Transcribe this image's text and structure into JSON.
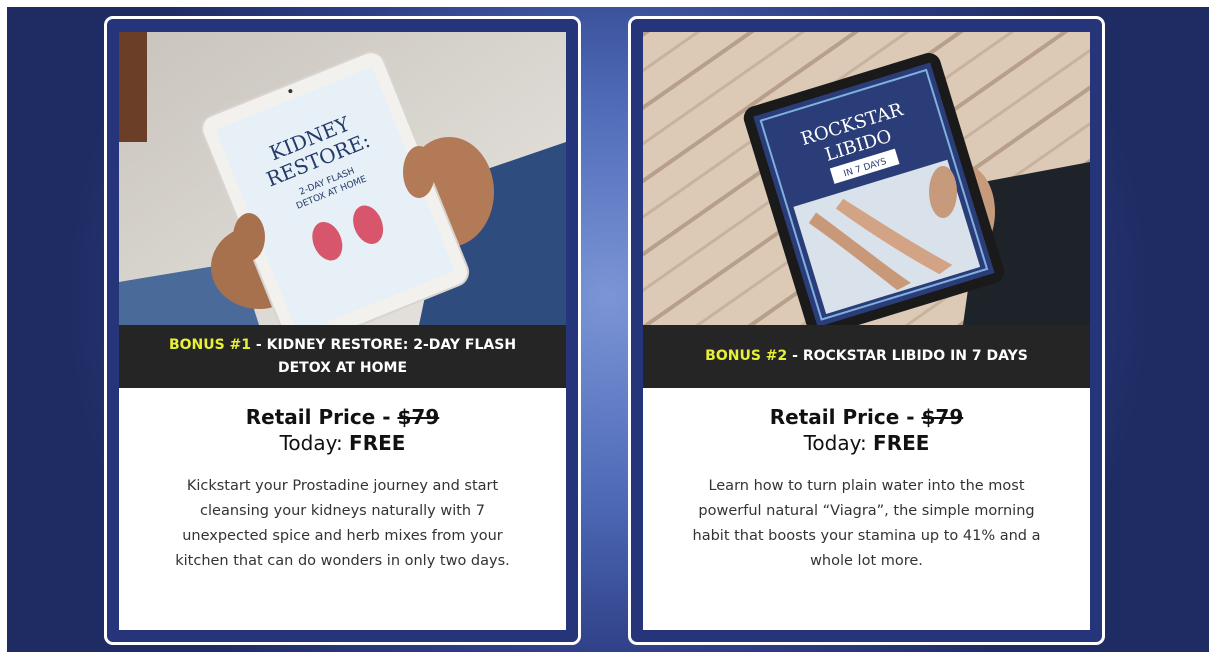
{
  "cards": [
    {
      "bonus_label": "BONUS #1",
      "title": " - KIDNEY RESTORE: 2-DAY FLASH DETOX AT HOME",
      "price_label": "Retail Price - ",
      "price_old": "$79",
      "today_label": "Today: ",
      "today_value": "FREE",
      "description": "Kickstart your Prostadine journey and start cleansing your kidneys naturally with 7 unexpected spice and herb mixes from your kitchen that can do wonders in only two days.",
      "ebook": {
        "line1": "KIDNEY",
        "line2": "RESTORE:",
        "sub1": "2-DAY FLASH",
        "sub2": "DETOX AT HOME"
      }
    },
    {
      "bonus_label": "BONUS #2",
      "title": " - ROCKSTAR LIBIDO IN 7 DAYS",
      "price_label": "Retail Price - ",
      "price_old": "$79",
      "today_label": "Today: ",
      "today_value": "FREE",
      "description": "Learn how to turn plain water into the most powerful natural “Viagra”, the simple morning habit that boosts your stamina up to 41% and a whole lot more.",
      "ebook": {
        "line1": "ROCKSTAR",
        "line2": "LIBIDO",
        "sub1": "IN 7 DAYS"
      }
    }
  ],
  "colors": {
    "bonus_highlight": "#e6f03a",
    "banner_bg": "#252525",
    "card_bg": "#26357a"
  }
}
